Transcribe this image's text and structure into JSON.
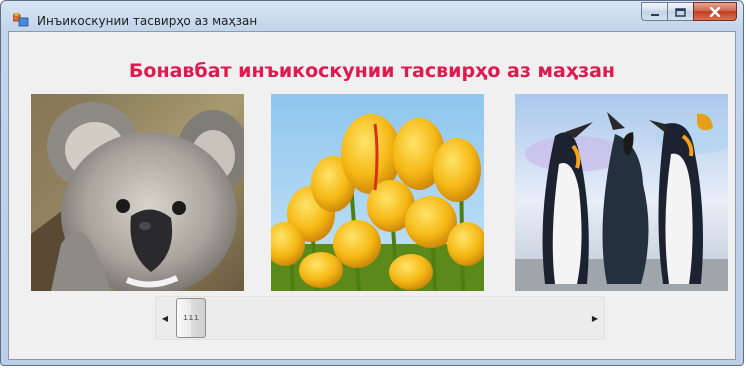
{
  "window": {
    "title": "Инъикоскунии тасвирҳо аз маҳзан",
    "caption_buttons": {
      "minimize_icon": "minimize-icon",
      "maximize_icon": "maximize-icon",
      "close_icon": "close-icon"
    }
  },
  "main": {
    "heading": "Бонавбат инъикоскунии тасвирҳо аз маҳзан",
    "heading_color": "#e0194f",
    "pictures": [
      {
        "subject": "koala"
      },
      {
        "subject": "tulips"
      },
      {
        "subject": "penguins"
      }
    ]
  },
  "scrollbar": {
    "orientation": "horizontal",
    "position_fraction": 0.0,
    "thumb_grip": "ııı",
    "left_arrow_icon": "arrow-left-icon",
    "right_arrow_icon": "arrow-right-icon"
  }
}
